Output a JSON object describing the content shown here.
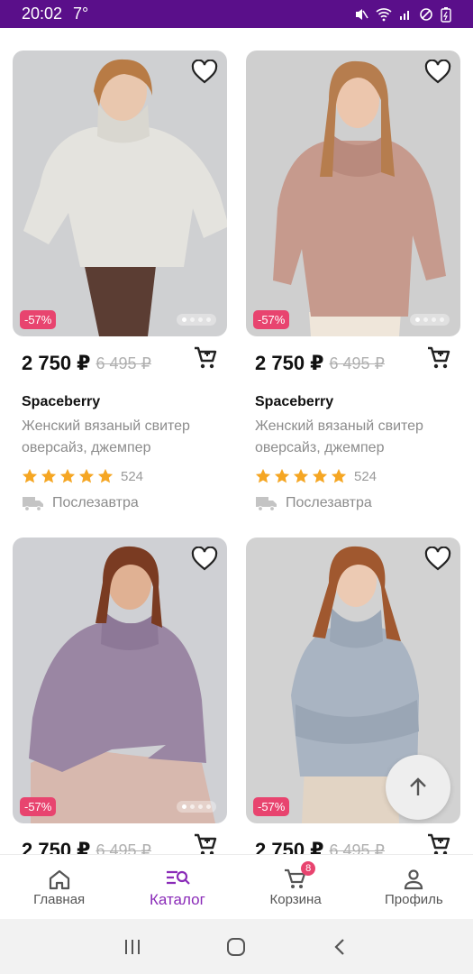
{
  "status": {
    "time": "20:02",
    "temperature": "7°"
  },
  "products": [
    {
      "price": "2 750 ₽",
      "old_price": "6 495 ₽",
      "brand": "Spaceberry",
      "title": "Женский вязаный свитер оверсайз, джемпер",
      "reviews": "524",
      "rating": 5,
      "delivery": "Послезавтра",
      "discount": "-57%",
      "image": "photo-cream-sweater",
      "bg_color": "#cfd0d2",
      "sweater_color": "#e4e3de"
    },
    {
      "price": "2 750 ₽",
      "old_price": "6 495 ₽",
      "brand": "Spaceberry",
      "title": "Женский вязаный свитер оверсайз, джемпер",
      "reviews": "524",
      "rating": 5,
      "delivery": "Послезавтра",
      "discount": "-57%",
      "image": "photo-pink-sweater",
      "bg_color": "#cfcfcf",
      "sweater_color": "#c69a8d"
    },
    {
      "price": "2 750 ₽",
      "old_price": "6 495 ₽",
      "discount": "-57%",
      "image": "photo-lilac-sweater",
      "bg_color": "#cfd0d4",
      "sweater_color": "#9a86a3"
    },
    {
      "price": "2 750 ₽",
      "old_price": "6 495 ₽",
      "discount": "-57%",
      "image": "photo-grey-sweater",
      "bg_color": "#d2d2d2",
      "sweater_color": "#a9b4c2"
    }
  ],
  "nav": {
    "home": "Главная",
    "catalog": "Каталог",
    "cart": "Корзина",
    "cart_count": "8",
    "profile": "Профиль"
  },
  "colors": {
    "brand": "#5a0f8a",
    "accent": "#8a2bb8",
    "badge": "#e8446f",
    "star": "#f5a623"
  }
}
